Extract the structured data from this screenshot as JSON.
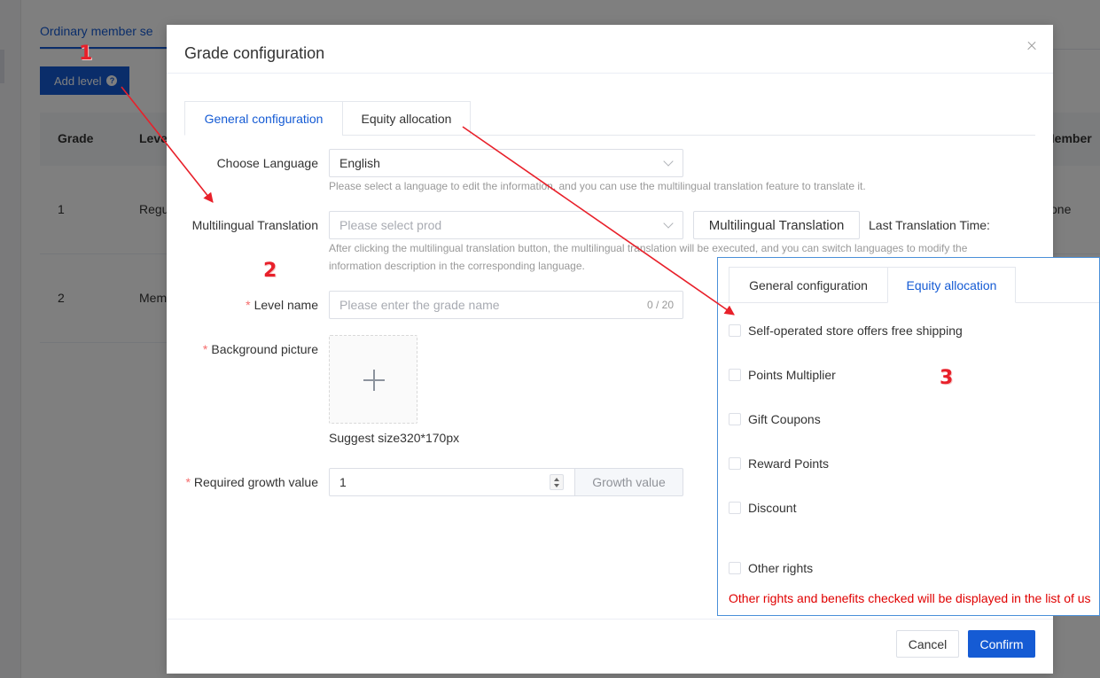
{
  "background": {
    "tab_label": "Ordinary member se",
    "add_level_label": "Add level",
    "help_icon": "question-icon",
    "table_headers": [
      "Grade",
      "Leve",
      "Member"
    ],
    "rows": [
      {
        "grade": "1",
        "level": "Regu",
        "member": "one"
      },
      {
        "grade": "2",
        "level": "Mem",
        "member": ""
      }
    ]
  },
  "dialog": {
    "title": "Grade configuration",
    "close_icon": "close-icon",
    "tabs": [
      {
        "label": "General configuration",
        "active": true
      },
      {
        "label": "Equity allocation",
        "active": false
      }
    ],
    "form": {
      "language_label": "Choose Language",
      "language_value": "English",
      "language_hint": "Please select a language to edit the information, and you can use the multilingual translation feature to translate it.",
      "translation_label": "Multilingual Translation",
      "translation_placeholder": "Please select prod",
      "translation_button": "Multilingual Translation",
      "last_translation_label": "Last Translation Time:",
      "translation_hint_line1": "After clicking the multilingual translation button, the multilingual translation will be executed, and you can switch languages to modify the",
      "translation_hint_line2": "information description in the corresponding language.",
      "required_mark": "*",
      "level_name_label": "Level name",
      "level_name_placeholder": "Please enter the grade name",
      "level_name_count": "0 / 20",
      "background_label": "Background picture",
      "suggest_size": "Suggest size320*170px",
      "growth_label": "Required growth value",
      "growth_value": "1",
      "growth_append": "Growth value"
    },
    "footer": {
      "cancel_label": "Cancel",
      "confirm_label": "Confirm"
    }
  },
  "inset": {
    "tabs": [
      {
        "label": "General configuration",
        "active": false
      },
      {
        "label": "Equity allocation",
        "active": true
      }
    ],
    "options": [
      {
        "label": "Self-operated store offers free shipping",
        "checked": false
      },
      {
        "label": "Points Multiplier",
        "checked": false
      },
      {
        "label": "Gift Coupons",
        "checked": false
      },
      {
        "label": "Reward Points",
        "checked": false
      },
      {
        "label": "Discount",
        "checked": false
      },
      {
        "label": "Other rights",
        "checked": false
      }
    ],
    "note": "Other rights and benefits checked will be displayed in the list of us"
  },
  "annotations": {
    "marker_1": "1",
    "marker_2": "2",
    "marker_3": "3",
    "color": "#e8202a"
  },
  "colors": {
    "primary": "#155bd4",
    "danger_text": "#e00000",
    "required_star": "#f56c6c"
  }
}
